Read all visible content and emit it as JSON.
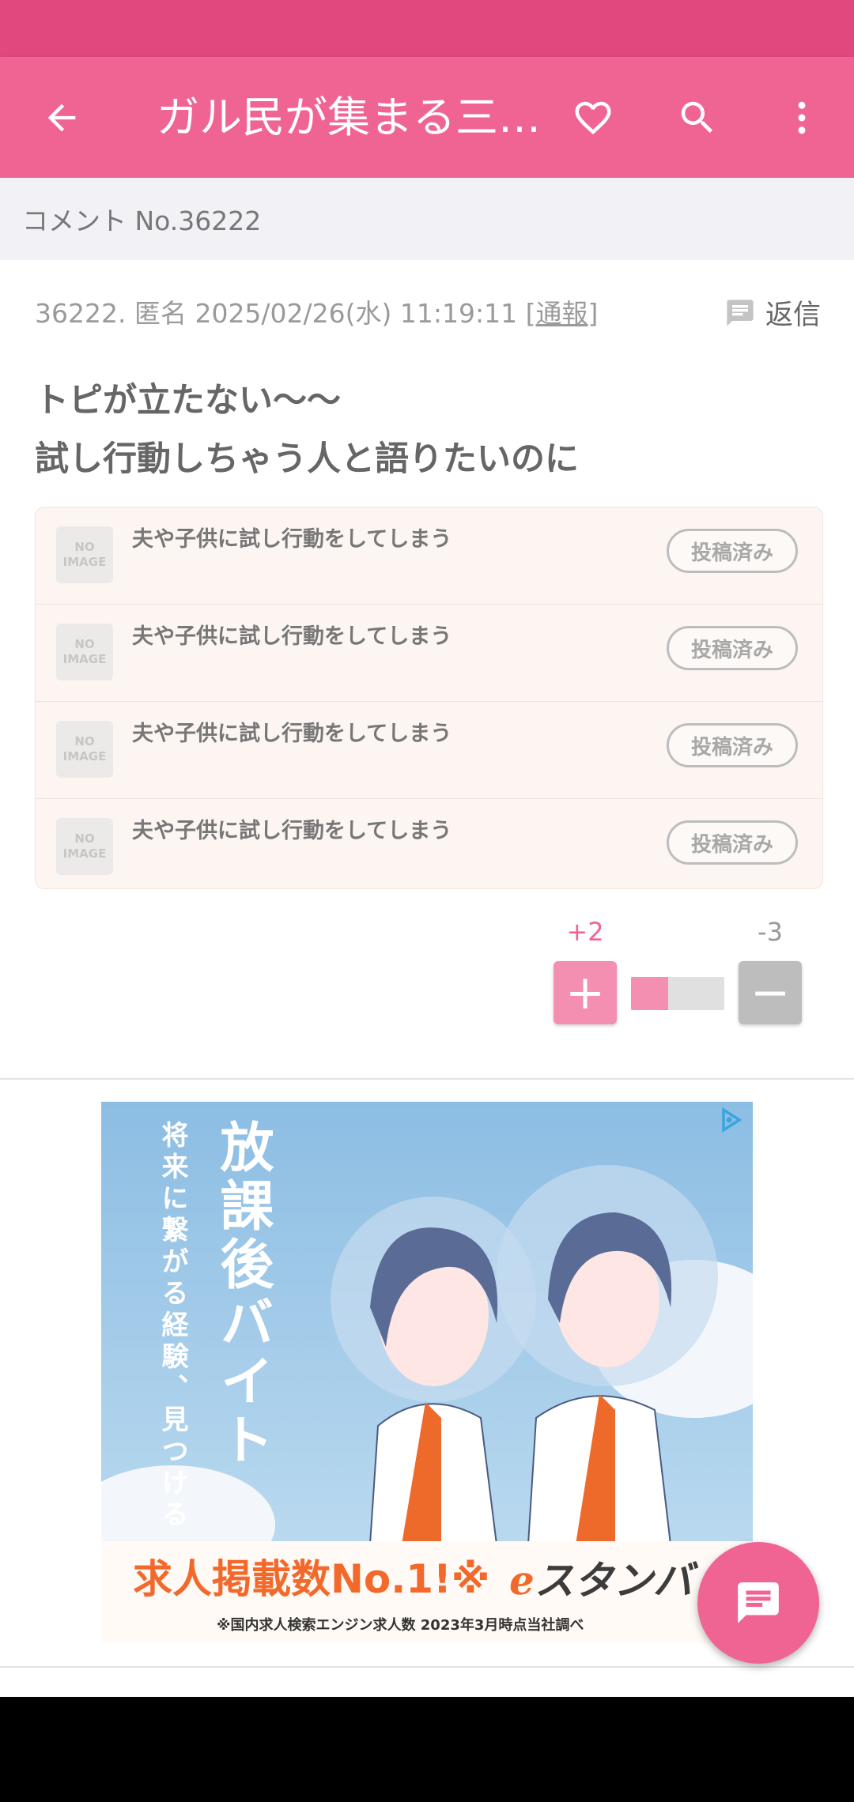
{
  "app_bar": {
    "title": "ガル民が集まる三…",
    "icons": [
      "back-arrow-icon",
      "heart-icon",
      "search-icon",
      "more-vert-icon"
    ]
  },
  "subheader": {
    "text": "コメント No.36222"
  },
  "comment": {
    "meta": "36222. 匿名 2025/02/26(水) 11:19:11",
    "report_open": "[",
    "report_label": "通報",
    "report_close": "]",
    "reply_label": "返信",
    "body_line1": "トピが立たない〜〜",
    "body_line2": "試し行動しちゃう人と語りたいのに"
  },
  "topics": [
    {
      "noimage_line1": "NO",
      "noimage_line2": "IMAGE",
      "title": "夫や子供に試し行動をしてしまう",
      "status": "投稿済み"
    },
    {
      "noimage_line1": "NO",
      "noimage_line2": "IMAGE",
      "title": "夫や子供に試し行動をしてしまう",
      "status": "投稿済み"
    },
    {
      "noimage_line1": "NO",
      "noimage_line2": "IMAGE",
      "title": "夫や子供に試し行動をしてしまう",
      "status": "投稿済み"
    },
    {
      "noimage_line1": "NO",
      "noimage_line2": "IMAGE",
      "title": "夫や子供に試し行動をしてしまう",
      "status": "投稿済み"
    }
  ],
  "votes": {
    "plus_count": "+2",
    "minus_count": "-3",
    "plus_symbol": "+",
    "minus_symbol": "−",
    "plus_ratio": 0.4
  },
  "ad": {
    "vertical_title": "放課後バイト",
    "vertical_sub": "将来に繋がる経験、見つける",
    "headline": "求人掲載数No.1!※",
    "brand": "スタンバ",
    "note": "※国内求人検索エンジン求人数 2023年3月時点当社調べ"
  },
  "colors": {
    "status_bar": "#e0487e",
    "app_bar": "#f06493",
    "plus": "#f48fb1",
    "minus": "#bdbdbd",
    "fab": "#f06493"
  }
}
